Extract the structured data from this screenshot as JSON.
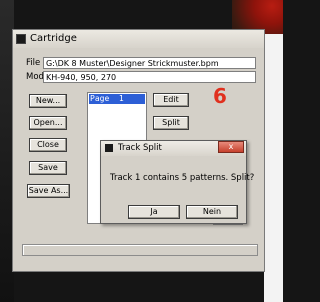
{
  "window": {
    "title": "Cartridge",
    "file_label": "File",
    "file_value": "G:\\DK 8 Muster\\Designer Strickmuster.bpm",
    "mode_label": "Mode",
    "mode_value": "KH-940, 950, 270",
    "buttons": {
      "new": "New...",
      "open": "Open...",
      "close": "Close",
      "save": "Save",
      "save_as": "Save As...",
      "edit": "Edit",
      "split": "Split"
    },
    "list": {
      "selected_item": "Page  1"
    },
    "annotation": "6"
  },
  "dialog": {
    "title": "Track Split",
    "close_glyph": "x",
    "message": "Track 1 contains 5 patterns. Split?",
    "yes_label": "Ja",
    "no_label": "Nein"
  }
}
